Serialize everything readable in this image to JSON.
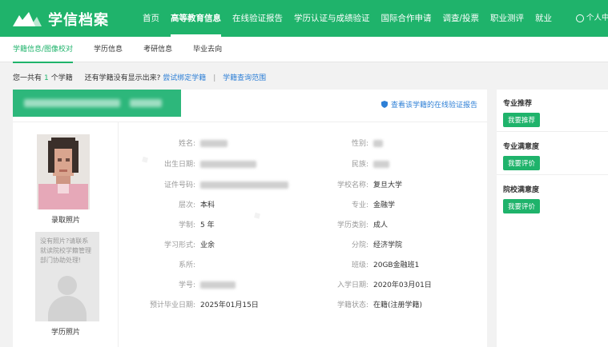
{
  "brand": {
    "name": "学信档案"
  },
  "nav": {
    "items": [
      {
        "label": "首页"
      },
      {
        "label": "高等教育信息",
        "active": true
      },
      {
        "label": "在线验证报告"
      },
      {
        "label": "学历认证与成绩验证"
      },
      {
        "label": "国际合作申请"
      },
      {
        "label": "调查/投票"
      },
      {
        "label": "职业测评"
      },
      {
        "label": "就业"
      }
    ],
    "user_label": "个人中心"
  },
  "subnav": {
    "items": [
      {
        "label": "学籍信息/图像校对",
        "active": true
      },
      {
        "label": "学历信息"
      },
      {
        "label": "考研信息"
      },
      {
        "label": "毕业去向"
      }
    ]
  },
  "notice": {
    "prefix": "您一共有",
    "count": "1",
    "suffix": "个学籍",
    "question": "还有学籍没有显示出来?",
    "bind_link": "尝试绑定学籍",
    "separator": "|",
    "scope_link": "学籍查询范围"
  },
  "card": {
    "verify_link": "查看该学籍的在线验证报告",
    "photo_label": "录取照片",
    "placeholder_text": "没有照片?请联系就读院校学籍管理部门协助处理!",
    "degree_photo_label": "学历照片",
    "fields": {
      "name_label": "姓名:",
      "gender_label": "性别:",
      "birth_label": "出生日期:",
      "ethnicity_label": "民族:",
      "id_label": "证件号码:",
      "school_label": "学校名称:",
      "school_value": "复旦大学",
      "level_label": "层次:",
      "level_value": "本科",
      "major_label": "专业:",
      "major_value": "金融学",
      "duration_label": "学制:",
      "duration_value": "5 年",
      "type_label": "学历类别:",
      "type_value": "成人",
      "form_label": "学习形式:",
      "form_value": "业余",
      "branch_label": "分院:",
      "branch_value": "经济学院",
      "dept_label": "系所:",
      "dept_value": "",
      "class_label": "班级:",
      "class_value": "20GB金融班1",
      "studentno_label": "学号:",
      "enroll_label": "入学日期:",
      "enroll_value": "2020年03月01日",
      "grad_label": "预计毕业日期:",
      "grad_value": "2025年01月15日",
      "status_label": "学籍状态:",
      "status_value": "在籍(注册学籍)"
    }
  },
  "side": {
    "blocks": [
      {
        "title": "专业推荐",
        "button": "我要推荐"
      },
      {
        "title": "专业满意度",
        "button": "我要评价"
      },
      {
        "title": "院校满意度",
        "button": "我要评价"
      }
    ]
  },
  "colors": {
    "brand_green": "#1fb36b",
    "link_blue": "#2d7fd6"
  }
}
